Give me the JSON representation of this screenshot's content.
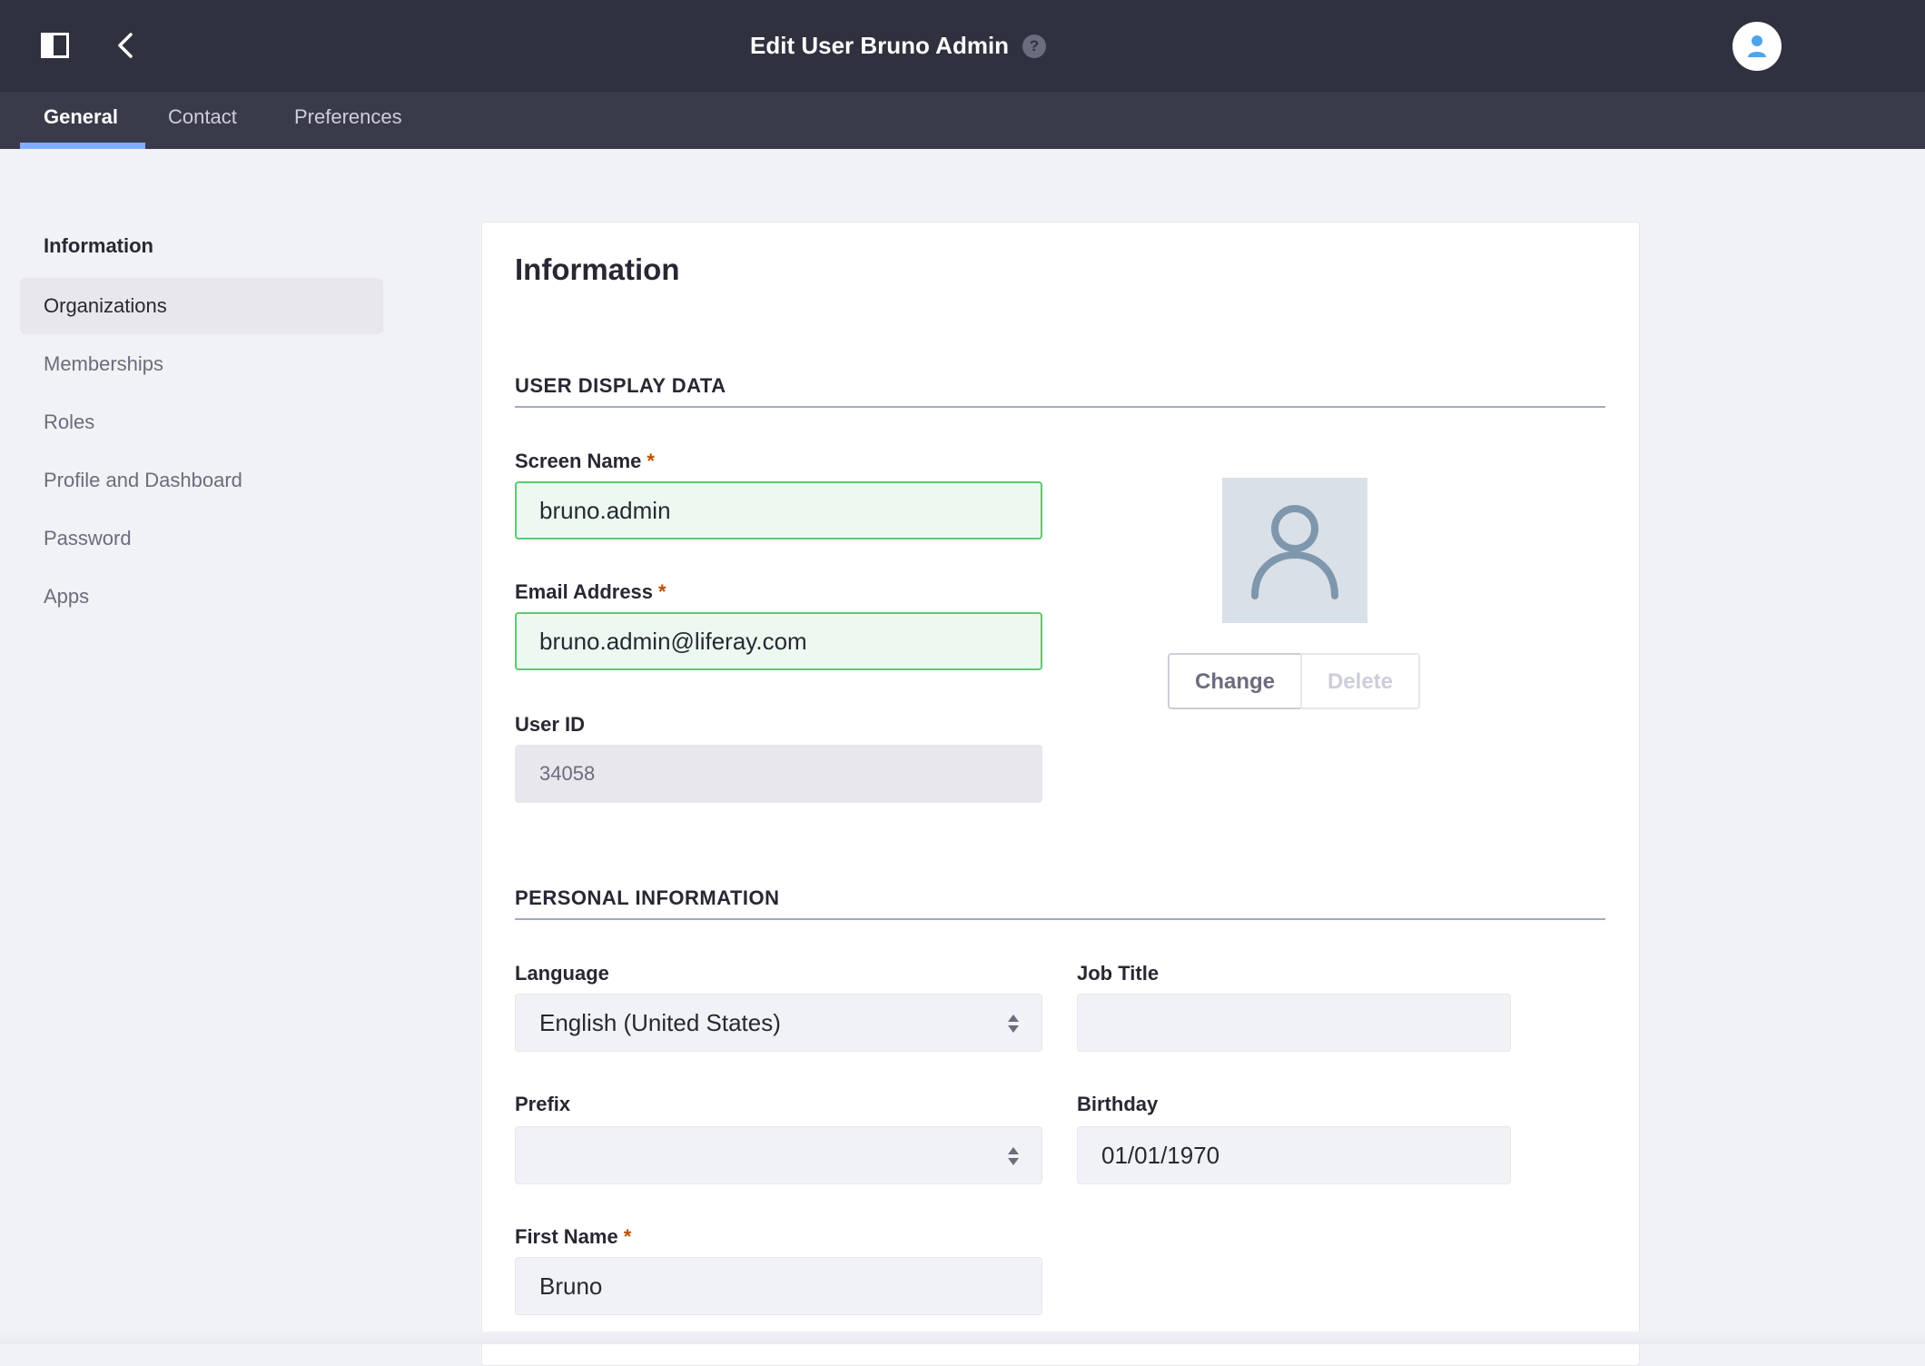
{
  "header": {
    "title": "Edit User Bruno Admin",
    "help_glyph": "?",
    "icons": [
      "panel-toggle-icon",
      "back-chevron-icon",
      "help-icon",
      "user-avatar-icon"
    ]
  },
  "tabs": [
    {
      "label": "General",
      "active": true
    },
    {
      "label": "Contact",
      "active": false
    },
    {
      "label": "Preferences",
      "active": false
    }
  ],
  "sidenav": {
    "title": "Information",
    "items": [
      {
        "label": "Organizations",
        "selected": true
      },
      {
        "label": "Memberships",
        "selected": false
      },
      {
        "label": "Roles",
        "selected": false
      },
      {
        "label": "Profile and Dashboard",
        "selected": false
      },
      {
        "label": "Password",
        "selected": false
      },
      {
        "label": "Apps",
        "selected": false
      }
    ]
  },
  "main": {
    "title": "Information",
    "user_display_data": {
      "section_title": "USER DISPLAY DATA",
      "screen_name": {
        "label": "Screen Name",
        "required_mark": "*",
        "value": "bruno.admin"
      },
      "email_address": {
        "label": "Email Address",
        "required_mark": "*",
        "value": "bruno.admin@liferay.com"
      },
      "user_id": {
        "label": "User ID",
        "value": "34058"
      },
      "portrait": {
        "change_label": "Change",
        "delete_label": "Delete"
      }
    },
    "personal_information": {
      "section_title": "PERSONAL INFORMATION",
      "language": {
        "label": "Language",
        "value": "English (United States)"
      },
      "job_title": {
        "label": "Job Title",
        "value": ""
      },
      "prefix": {
        "label": "Prefix",
        "value": ""
      },
      "birthday": {
        "label": "Birthday",
        "value": "01/01/1970"
      },
      "first_name": {
        "label": "First Name",
        "required_mark": "*",
        "value": "Bruno"
      }
    }
  },
  "colors": {
    "header_bg": "#30313f",
    "tabbar_bg": "#393a4a",
    "tab_active_indicator": "#80acff",
    "valid_border": "#5aca75",
    "required_mark": "#b95000",
    "avatar_accent": "#4fa3e8"
  }
}
